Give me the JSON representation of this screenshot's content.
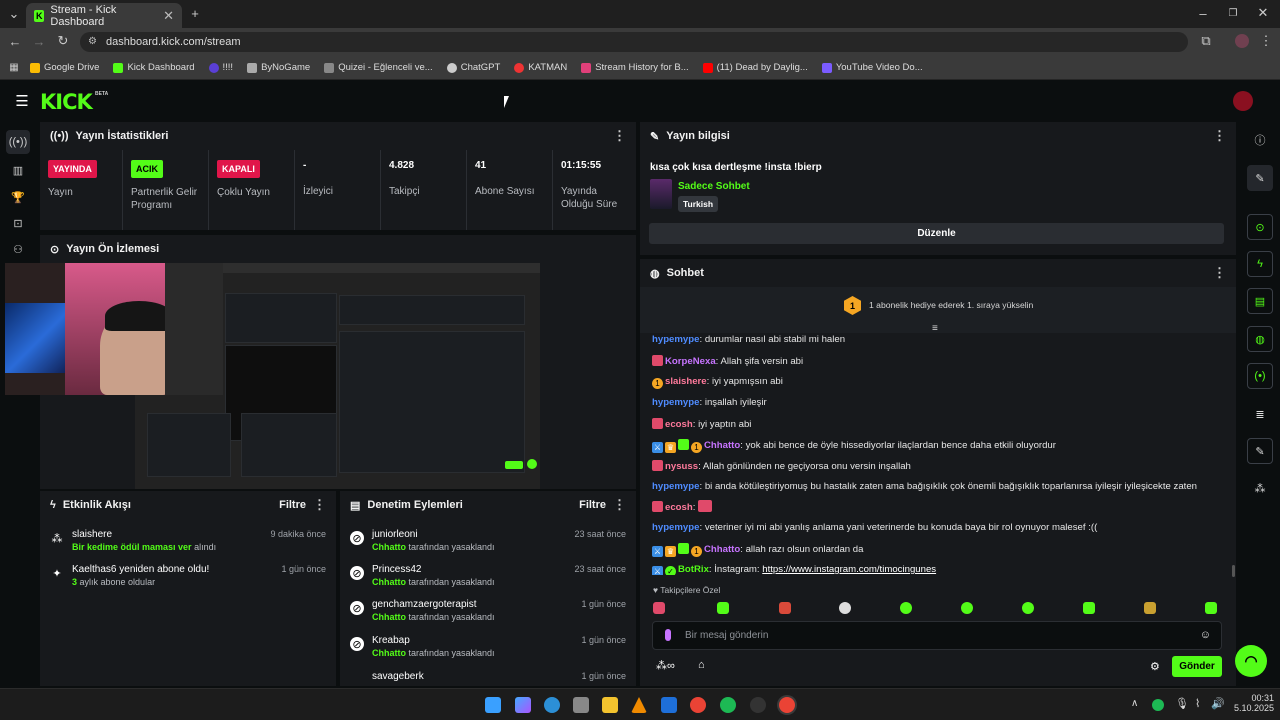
{
  "browser": {
    "tab_title": "Stream - Kick Dashboard",
    "url": "dashboard.kick.com/stream",
    "bookmarks": [
      "Google Drive",
      "Kick Dashboard",
      "!!!!",
      "ByNoGame",
      "Quizei - Eğlenceli ve...",
      "ChatGPT",
      "KATMAN",
      "Stream History for B...",
      "(11) Dead by Daylig...",
      "YouTube Video Do..."
    ]
  },
  "app": {
    "logo": "KICK",
    "logo_badge": "BETA"
  },
  "stats": {
    "title": "Yayın İstatistikleri",
    "items": [
      {
        "badge": "YAYINDA",
        "label": "Yayın"
      },
      {
        "badge": "ACIK",
        "label": "Partnerlik Gelir Programı"
      },
      {
        "badge": "KAPALI",
        "label": "Çoklu Yayın"
      },
      {
        "value": "-",
        "label": "İzleyici"
      },
      {
        "value": "4.828",
        "label": "Takipçi"
      },
      {
        "value": "41",
        "label": "Abone Sayısı"
      },
      {
        "value": "01:15:55",
        "label": "Yayında Olduğu Süre"
      }
    ]
  },
  "preview": {
    "title": "Yayın Ön İzlemesi"
  },
  "activity": {
    "title": "Etkinlik Akışı",
    "filter": "Filtre",
    "items": [
      {
        "name": "slaishere",
        "time": "9 dakika önce",
        "sub_green": "Bir kedime ödül maması ver",
        "sub": " alındı"
      },
      {
        "name": "Kaelthas6 yeniden abone oldu!",
        "time": "1 gün önce",
        "sub_green": "3",
        "sub": " aylık abone oldular"
      }
    ]
  },
  "moderation": {
    "title": "Denetim Eylemleri",
    "filter": "Filtre",
    "suffix": " tarafından yasaklandı",
    "items": [
      {
        "name": "juniorleoni",
        "by": "Chhatto",
        "time": "23 saat önce"
      },
      {
        "name": "Princess42",
        "by": "Chhatto",
        "time": "23 saat önce"
      },
      {
        "name": "genchamzaergoterapist",
        "by": "Chhatto",
        "time": "1 gün önce"
      },
      {
        "name": "Kreabap",
        "by": "Chhatto",
        "time": "1 gün önce"
      },
      {
        "name": "savageberk",
        "by": "",
        "time": "1 gün önce"
      }
    ]
  },
  "stream_info": {
    "title": "Yayın bilgisi",
    "stream_title": "kısa çok kısa dertleşme !insta !bierp",
    "category": "Sadece Sohbet",
    "language": "Turkish",
    "edit": "Düzenle"
  },
  "chat": {
    "title": "Sohbet",
    "pinned_number": "1",
    "pinned": "1 abonelik hediye ederek 1. sıraya yükselin",
    "messages": [
      {
        "user": "hypemype",
        "color": "#4f8cff",
        "text": "durumlar nasıl abi stabil mi halen"
      },
      {
        "user": "KorpeNexa",
        "color": "#c774ff",
        "text": "Allah şifa versin abi"
      },
      {
        "user": "slaishere",
        "color": "#ff7a9c",
        "text": "iyi yapmışsın abi"
      },
      {
        "user": "hypemype",
        "color": "#4f8cff",
        "text": "inşallah iyileşir"
      },
      {
        "user": "ecosh",
        "color": "#ff7a9c",
        "text": "iyi yaptın abi"
      },
      {
        "user": "Chhatto",
        "color": "#c774ff",
        "text": "yok abi bence de öyle hissediyorlar ilaçlardan bence daha etkili oluyordur"
      },
      {
        "user": "nysuss",
        "color": "#ff7a9c",
        "text": "Allah gönlünden ne geçiyorsa onu versin inşallah"
      },
      {
        "user": "hypemype",
        "color": "#4f8cff",
        "text": "bi anda kötüleştiriyomuş bu hastalık zaten ama bağışıklık çok önemli bağışıklık toparlanırsa iyileşir iyileşicekte zaten"
      },
      {
        "user": "ecosh",
        "color": "#ff7a9c",
        "text": ""
      },
      {
        "user": "hypemype",
        "color": "#4f8cff",
        "text": "veteriner iyi mi abi yanlış anlama yani veterinerde bu konuda baya bir rol oynuyor malesef :(("
      },
      {
        "user": "Chhatto",
        "color": "#c774ff",
        "text": "allah razı olsun onlardan da"
      },
      {
        "user": "BotRix",
        "color": "#53fc18",
        "text": "İnstagram: ",
        "link": "https://www.instagram.com/timocingunes"
      }
    ],
    "emote_section": "Takipçilere Özel",
    "input_placeholder": "Bir mesaj gönderin",
    "send": "Gönder"
  },
  "taskbar": {
    "time": "00:31",
    "date": "5.10.2025"
  }
}
